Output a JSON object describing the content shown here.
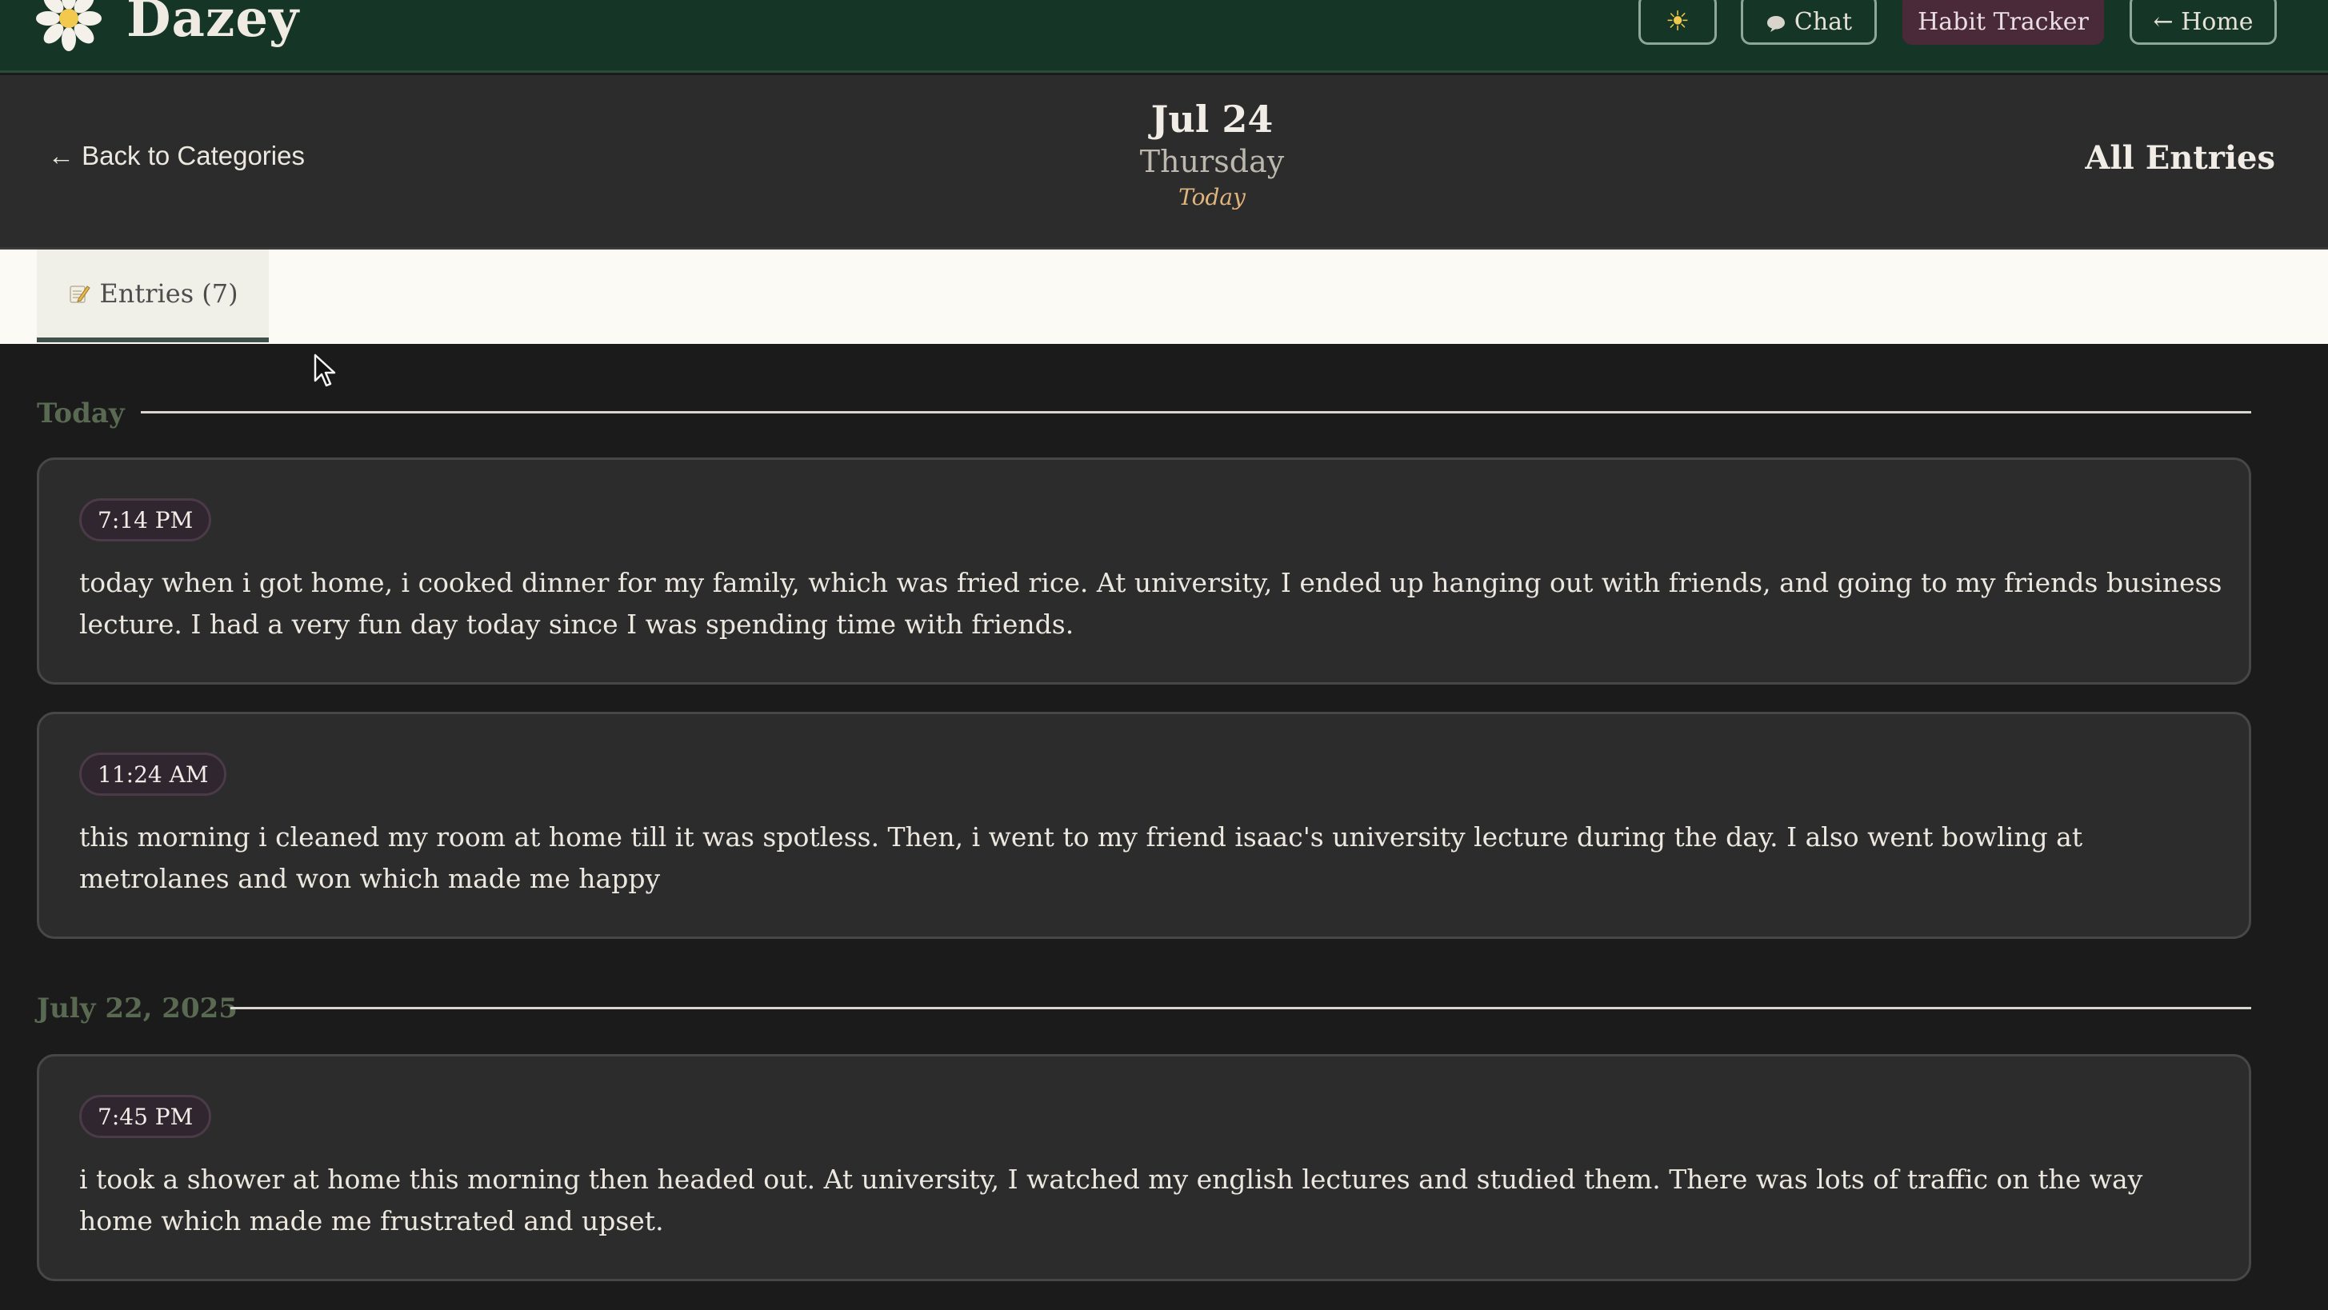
{
  "topbar": {
    "brand": "Dazey",
    "theme_toggle": "☀",
    "chat": "Chat",
    "habit_tracker": "Habit Tracker",
    "home": "← Home"
  },
  "header": {
    "back": "← Back to Categories",
    "date": "Jul 24",
    "weekday": "Thursday",
    "relative": "Today",
    "all_entries": "All Entries"
  },
  "tabs": [
    {
      "label": "Entries (7)",
      "active": true
    }
  ],
  "sections": [
    {
      "label": "Today",
      "entries": [
        {
          "time": "7:14 PM",
          "text": "today when i got home, i cooked dinner for my family, which was fried rice. At university, I ended up hanging out with friends, and going to my friends business lecture. I had a very fun day today since I was spending time with friends."
        },
        {
          "time": "11:24 AM",
          "text": "this morning i cleaned my room at home till it was spotless. Then, i went to my friend isaac's university lecture during the day. I also went bowling at metrolanes and won which made me happy"
        }
      ]
    },
    {
      "label": "July 22, 2025",
      "entries": [
        {
          "time": "7:45 PM",
          "text": "i took a shower at home this morning then headed out. At university, I watched my english lectures and studied them. There was lots of traffic on the way home which made me frustrated and upset."
        }
      ]
    }
  ],
  "colors": {
    "topbar_bg": "#153527",
    "habit_button_bg": "#4a2a38",
    "accent_today": "#e0b47c",
    "section_label": "#5a6a52"
  }
}
